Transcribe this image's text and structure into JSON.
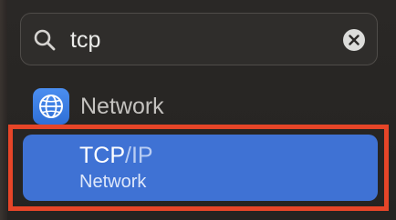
{
  "search": {
    "query": "tcp",
    "search_icon": "magnifying-glass-icon",
    "clear_icon": "clear-x-icon"
  },
  "category": {
    "label": "Network",
    "icon": "globe-icon",
    "icon_color": "#3f7fe6"
  },
  "result": {
    "title_match": "TCP",
    "title_rest": "/IP",
    "subtitle": "Network",
    "selected_color": "#3f72d4"
  },
  "annotation": {
    "highlight_color": "#e64528"
  }
}
